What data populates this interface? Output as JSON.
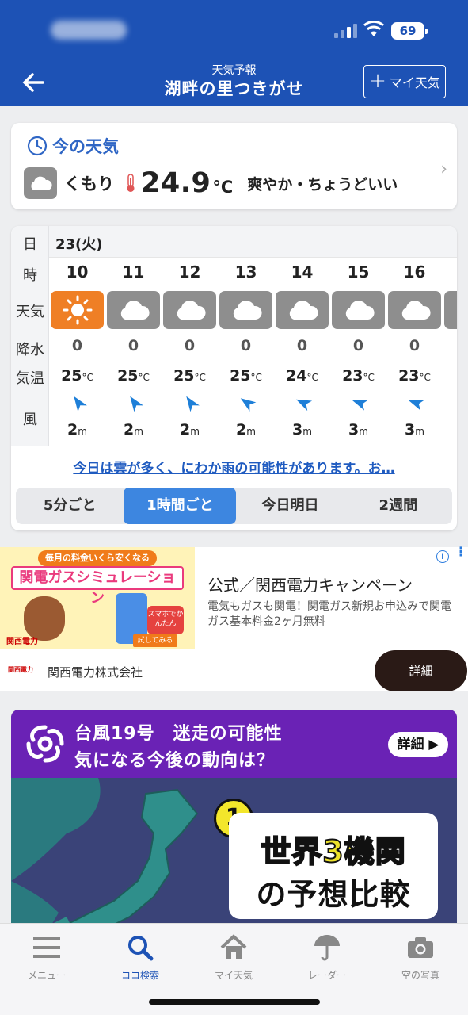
{
  "status_bar": {
    "battery": "69"
  },
  "header": {
    "subtitle": "天気予報",
    "title": "湖畔の里つきがせ",
    "my_weather_button": "マイ天気"
  },
  "current": {
    "heading": "今の天気",
    "condition": "くもり",
    "temperature": "24.9",
    "unit": "°C",
    "comment": "爽やか・ちょうどいい"
  },
  "forecast": {
    "labels": {
      "day": "日",
      "hour": "時",
      "weather": "天気",
      "rain": "降水",
      "temp": "気温",
      "wind": "風"
    },
    "day": "23(火)",
    "hours": [
      {
        "hour": "10",
        "icon": "sun-icon",
        "rain": "0",
        "temp": "25",
        "wind_speed": "2"
      },
      {
        "hour": "11",
        "icon": "cloud-icon",
        "rain": "0",
        "temp": "25",
        "wind_speed": "2"
      },
      {
        "hour": "12",
        "icon": "cloud-icon",
        "rain": "0",
        "temp": "25",
        "wind_speed": "2"
      },
      {
        "hour": "13",
        "icon": "cloud-icon",
        "rain": "0",
        "temp": "25",
        "wind_speed": "2"
      },
      {
        "hour": "14",
        "icon": "cloud-icon",
        "rain": "0",
        "temp": "24",
        "wind_speed": "3"
      },
      {
        "hour": "15",
        "icon": "cloud-icon",
        "rain": "0",
        "temp": "23",
        "wind_speed": "3"
      },
      {
        "hour": "16",
        "icon": "cloud-icon",
        "rain": "0",
        "temp": "23",
        "wind_speed": "3"
      }
    ],
    "temp_unit": "°C",
    "wind_unit": "m",
    "summary_link": "今日は雲が多く、にわか雨の可能性があります。お…",
    "tabs": [
      "5分ごと",
      "1時間ごと",
      "今日明日",
      "2週間"
    ]
  },
  "ad": {
    "image_banner": "毎月の料金いくら安くなるの？",
    "image_headline": "関電ガスシミュレーション",
    "image_badge": "スマホでかんたん",
    "image_button": "試してみる",
    "image_logo": "関西電力",
    "title": "公式／関西電力キャンペーン",
    "description": "電気もガスも関電！関電ガス新規お申込みで関電ガス基本料金2ヶ月無料",
    "logo_text": "関西電力",
    "company": "関西電力株式会社",
    "cta": "詳細"
  },
  "typhoon": {
    "line1": "台風19号　迷走の可能性",
    "line2": "気になる今後の動向は？",
    "button": "詳細",
    "badge_number": "1",
    "bubble_line1": "世界3機関",
    "bubble_line2": "の予想比較"
  },
  "tab_bar": [
    {
      "label": "メニュー",
      "icon": "menu-icon"
    },
    {
      "label": "ココ検索",
      "icon": "search-icon"
    },
    {
      "label": "マイ天気",
      "icon": "home-icon"
    },
    {
      "label": "レーダー",
      "icon": "umbrella-icon"
    },
    {
      "label": "空の写真",
      "icon": "camera-icon"
    }
  ],
  "colors": {
    "primary": "#1d52b5",
    "sun": "#ef7f25",
    "cloud_tile": "#8e8e8e",
    "active_tab": "#3d86e0",
    "link": "#1f5bc0"
  }
}
